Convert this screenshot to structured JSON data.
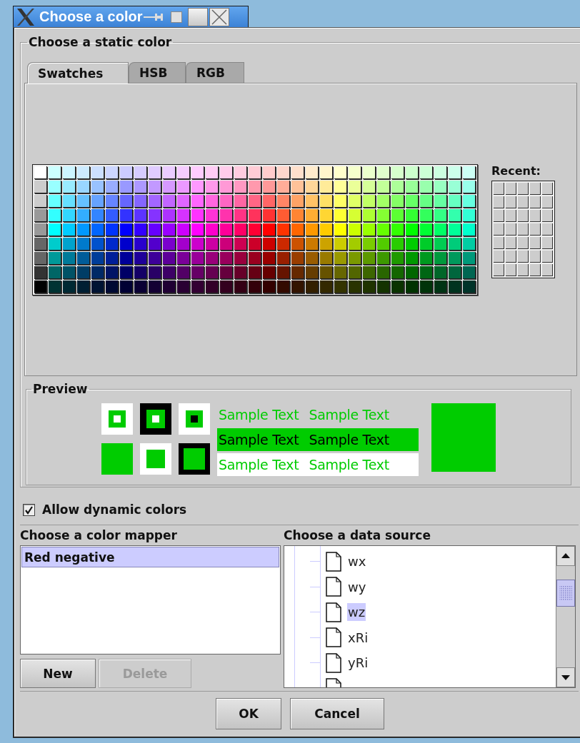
{
  "window": {
    "title": "Choose a color"
  },
  "static_color": {
    "title": "Choose a static color",
    "tabs": [
      {
        "label": "Swatches",
        "selected": true
      },
      {
        "label": "HSB",
        "selected": false
      },
      {
        "label": "RGB",
        "selected": false
      }
    ],
    "swatches": {
      "greys": [
        {
          "color": "#ffffff"
        },
        {
          "color": "#cccccc"
        },
        {
          "color": "#cccccc"
        },
        {
          "color": "#999999"
        },
        {
          "color": "#999999"
        },
        {
          "color": "#666666"
        },
        {
          "color": "#666666"
        },
        {
          "color": "#333333"
        },
        {
          "color": "#000000"
        }
      ],
      "hues": [
        {
          "color": "#00ffff"
        },
        {
          "color": "#00ccff"
        },
        {
          "color": "#0099ff"
        },
        {
          "color": "#0066ff"
        },
        {
          "color": "#0033ff"
        },
        {
          "color": "#0000ff"
        },
        {
          "color": "#3300ff"
        },
        {
          "color": "#6600ff"
        },
        {
          "color": "#9900ff"
        },
        {
          "color": "#cc00ff"
        },
        {
          "color": "#ff00ff"
        },
        {
          "color": "#ff00cc"
        },
        {
          "color": "#ff0099"
        },
        {
          "color": "#ff0066"
        },
        {
          "color": "#ff0033"
        },
        {
          "color": "#ff0000"
        },
        {
          "color": "#ff3300"
        },
        {
          "color": "#ff6600"
        },
        {
          "color": "#ff9900"
        },
        {
          "color": "#ffcc00"
        },
        {
          "color": "#ffff00"
        },
        {
          "color": "#ccff00"
        },
        {
          "color": "#99ff00"
        },
        {
          "color": "#66ff00"
        },
        {
          "color": "#33ff00"
        },
        {
          "color": "#00ff00"
        },
        {
          "color": "#00ff33"
        },
        {
          "color": "#00ff66"
        },
        {
          "color": "#00ff99"
        },
        {
          "color": "#00ffcc"
        }
      ]
    },
    "recent_label": "Recent:",
    "preview": {
      "title": "Preview",
      "color": "#00cc00",
      "sample_texts": [
        "Sample Text",
        "Sample Text",
        "Sample Text",
        "Sample Text",
        "Sample Text",
        "Sample Text"
      ]
    }
  },
  "dynamic": {
    "label": "Allow dynamic colors",
    "checked": true
  },
  "color_mapper": {
    "title": "Choose a color mapper",
    "items": [
      {
        "label": "Red negative",
        "selected": true
      }
    ],
    "buttons": [
      {
        "label": "New",
        "disabled": false
      },
      {
        "label": "Delete",
        "disabled": true
      }
    ]
  },
  "data_source": {
    "title": "Choose a data source",
    "items": [
      {
        "label": "wx",
        "selected": false
      },
      {
        "label": "wy",
        "selected": false
      },
      {
        "label": "wz",
        "selected": true
      },
      {
        "label": "xRi",
        "selected": false
      },
      {
        "label": "yRi",
        "selected": false
      }
    ]
  },
  "buttons": [
    "OK",
    "Cancel"
  ]
}
